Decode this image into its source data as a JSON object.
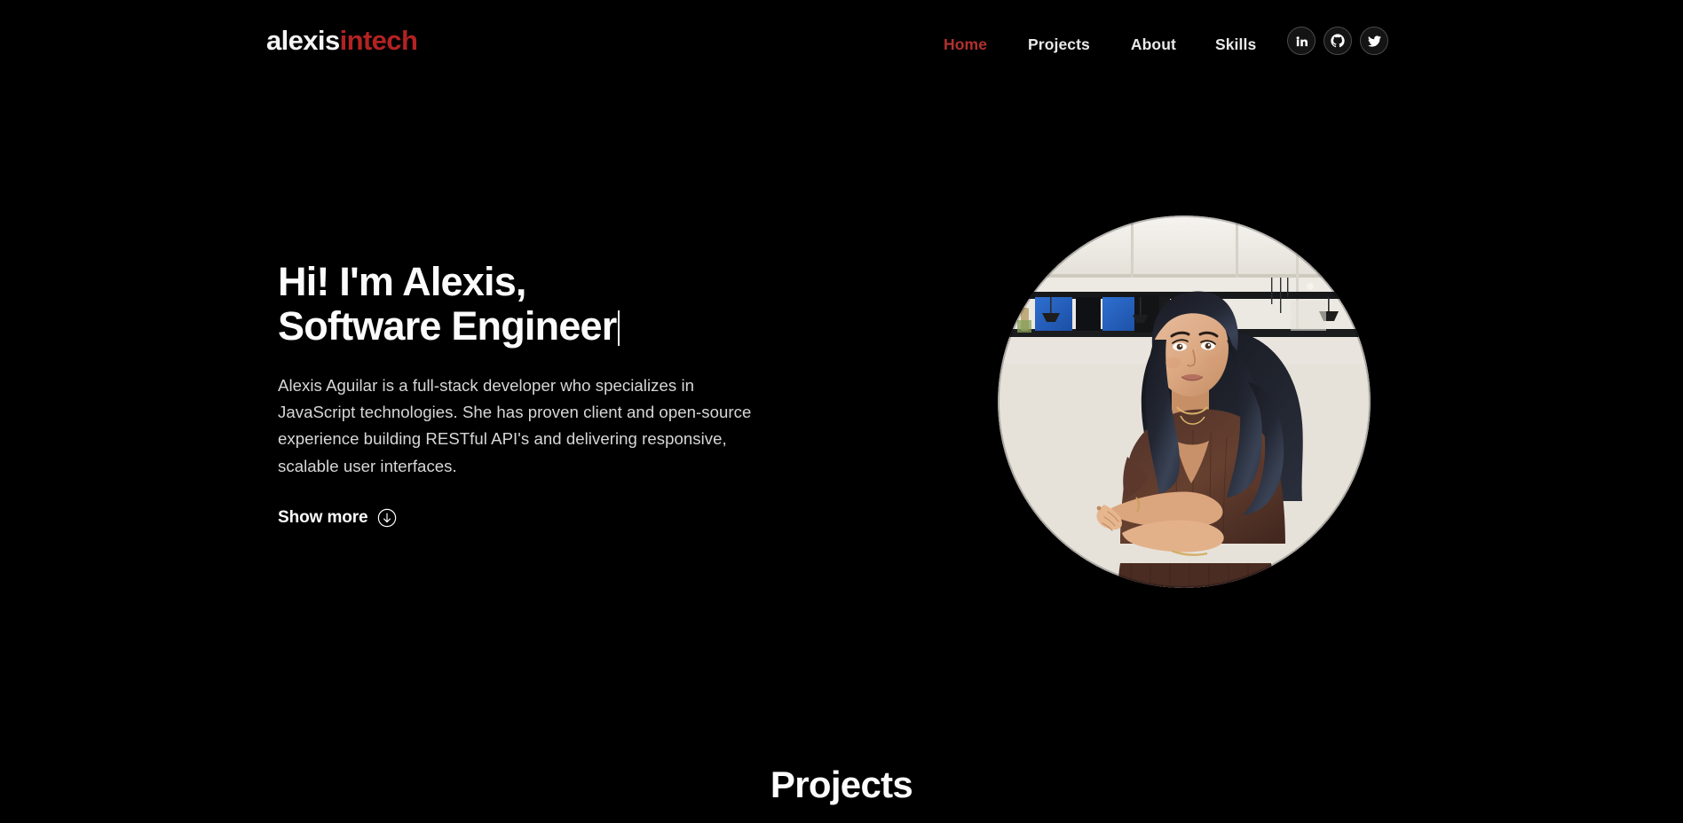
{
  "site": {
    "background_color": "#000000",
    "accent_color": "#b1312f",
    "text_color": "#fbfbfb",
    "muted_text_color": "#d7d7d7"
  },
  "header": {
    "brand": {
      "first": "alexis",
      "second": "intech",
      "first_color": "#f4f4f4",
      "second_color": "#b32222"
    },
    "nav": [
      {
        "label": "Home",
        "active": true,
        "icon": "nav-home"
      },
      {
        "label": "Projects",
        "active": false,
        "icon": "nav-projects"
      },
      {
        "label": "About",
        "active": false,
        "icon": "nav-about"
      },
      {
        "label": "Skills",
        "active": false,
        "icon": "nav-skills"
      }
    ],
    "socials": [
      {
        "name": "LinkedIn",
        "icon": "linkedin-icon"
      },
      {
        "name": "GitHub",
        "icon": "github-icon"
      },
      {
        "name": "Twitter",
        "icon": "twitter-icon"
      }
    ]
  },
  "hero": {
    "title_line1": "Hi! I'm Alexis,",
    "title_line2": "Software Engineer",
    "typing_caret": true,
    "description": "Alexis Aguilar is a full-stack developer who specializes in JavaScript technologies. She has proven client and open-source experience building RESTful API's and delivering responsive, scalable user interfaces.",
    "show_more_label": "Show more",
    "show_more_icon": "arrow-down-circle-icon",
    "portrait_alt": "Portrait of Alexis Aguilar"
  },
  "projects": {
    "heading": "Projects"
  }
}
